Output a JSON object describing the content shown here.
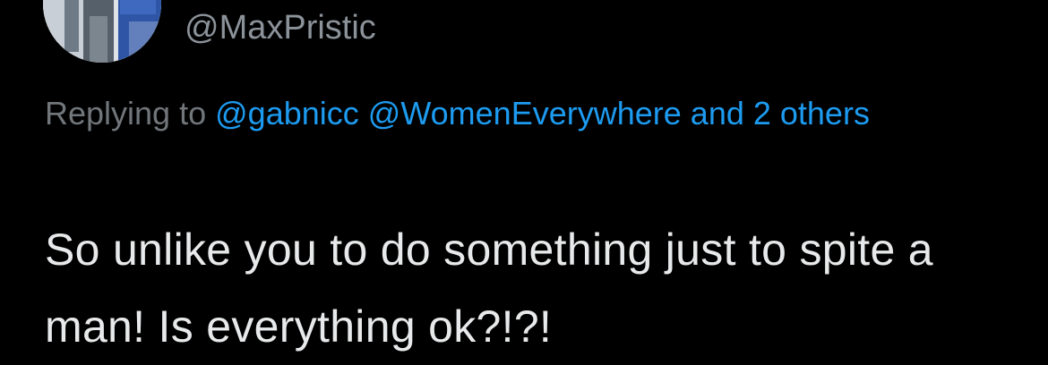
{
  "tweet": {
    "author_handle": "@MaxPristic",
    "reply_prefix": "Replying to",
    "reply_mentions": [
      "@gabnicc",
      "@WomenEverywhere"
    ],
    "reply_others": "and 2 others",
    "body_text": "So unlike you to do something just to spite a man! Is everything ok?!?!"
  },
  "colors": {
    "background": "#000000",
    "handle": "#8b9299",
    "reply_prefix": "#71767b",
    "mention": "#1d9bf0",
    "body": "#e7e9ea"
  }
}
